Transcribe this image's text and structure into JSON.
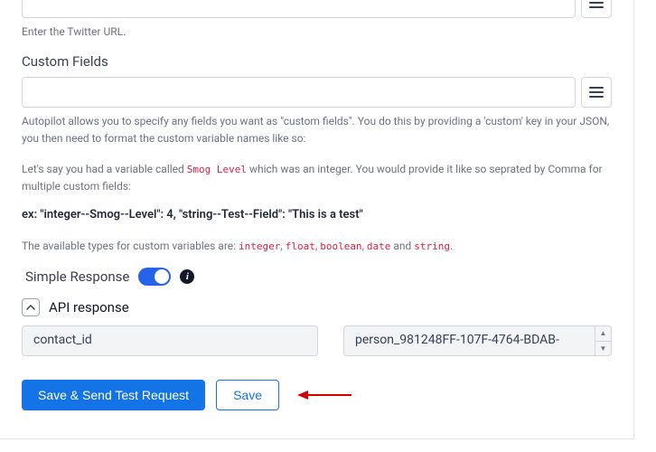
{
  "twitter": {
    "value": "",
    "helper": "Enter the Twitter URL."
  },
  "customFields": {
    "label": "Custom Fields",
    "value": "",
    "helper_line1": "Autopilot allows you to specify any fields you want as \"custom fields\". You do this by providing a 'custom' key in your JSON, you then need to format the custom variable names like so:",
    "helper_line2a": "Let's say you had a variable called ",
    "helper_line2_code": "Smog Level",
    "helper_line2b": " which was an integer. You would provide it like so seprated by Comma for multiple custom fields:",
    "example": "ex: \"integer--Smog--Level\": 4, \"string--Test--Field\": \"This is a test\"",
    "types_intro": "The available types for custom variables are: ",
    "types": [
      "integer",
      "float",
      "boolean",
      "date"
    ],
    "types_and": " and ",
    "types_last": "string",
    "types_period": "."
  },
  "simpleResponse": {
    "label": "Simple Response",
    "enabled": true
  },
  "apiResponse": {
    "label": "API response",
    "key": "contact_id",
    "value": "person_981248FF-107F-4764-BDAB-"
  },
  "buttons": {
    "saveSend": "Save & Send Test Request",
    "save": "Save"
  }
}
